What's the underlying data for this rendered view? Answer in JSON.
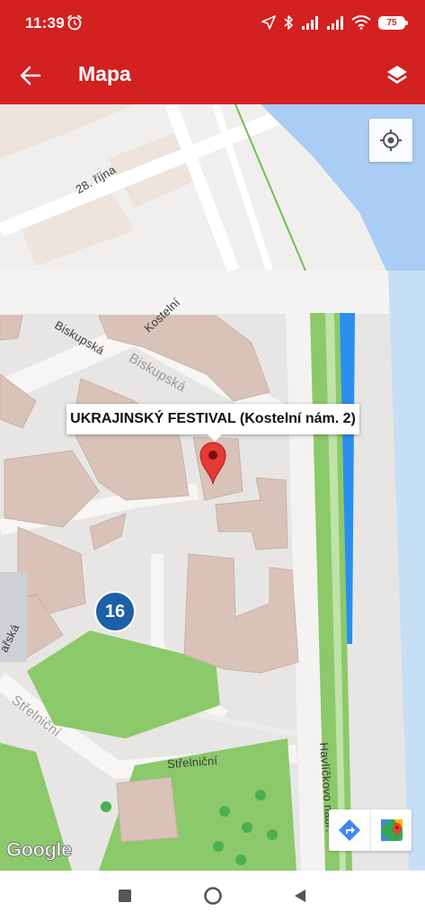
{
  "status_bar": {
    "time": "11:39",
    "battery": "75",
    "icons": [
      "alarm-icon",
      "location-arrow-icon",
      "bluetooth-icon",
      "signal-icon",
      "signal-icon",
      "wifi-icon",
      "battery-icon"
    ]
  },
  "app_bar": {
    "title": "Mapa",
    "back_icon": "arrow-left-icon",
    "layers_icon": "layers-icon"
  },
  "map": {
    "streets": {
      "s28rijna": "28. října",
      "biskupska1": "Biskupská",
      "kostelni": "Kostelní",
      "biskupska2": "Biskupská",
      "strelnicni1": "Střelniční",
      "strelnicni2": "Střelniční",
      "havlickovo": "Havlíčkovo nábř.",
      "arska": "ařská"
    },
    "info_window": "UKRAJINSKÝ FESTIVAL (Kostelní nám. 2)",
    "poi_number": "16",
    "google_logo": "Google",
    "colors": {
      "app_red": "#d32020",
      "water": "#aacdf5",
      "park": "#8cc96a",
      "building": "#d9c3b8",
      "marker": "#e53935",
      "poi": "#1d5fa8"
    }
  },
  "nav_bar": {
    "icons": [
      "recent-apps-icon",
      "home-icon",
      "back-triangle-icon"
    ]
  }
}
